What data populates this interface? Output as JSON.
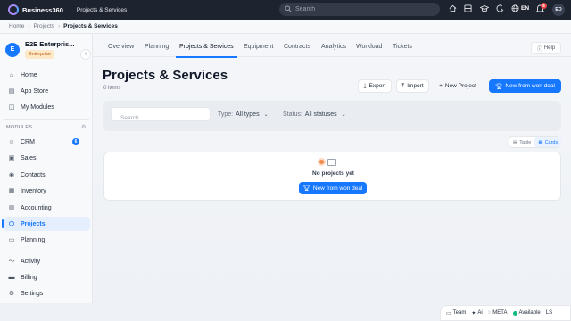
{
  "topbar": {
    "brand": "Business360",
    "section": "Projects & Services",
    "search_placeholder": "Search",
    "language": "EN",
    "notification_count": "8",
    "user_initials": "EO"
  },
  "breadcrumb": [
    "Home",
    "Projects",
    "Projects & Services"
  ],
  "sidebar": {
    "org_initial": "E",
    "org_name": "E2E Enterpris...",
    "org_plan": "Enterprise",
    "collapse_glyph": "‹",
    "top_items": [
      {
        "label": "Home",
        "icon": "home-icon"
      },
      {
        "label": "App Store",
        "icon": "store-icon"
      },
      {
        "label": "My Modules",
        "icon": "modules-icon"
      }
    ],
    "modules_label": "MODULES",
    "module_items": [
      {
        "label": "CRM",
        "icon": "crm-icon",
        "badge": "6"
      },
      {
        "label": "Sales",
        "icon": "sales-icon"
      },
      {
        "label": "Contacts",
        "icon": "contacts-icon"
      },
      {
        "label": "Inventory",
        "icon": "inventory-icon"
      },
      {
        "label": "Accounting",
        "icon": "accounting-icon"
      },
      {
        "label": "Projects",
        "icon": "projects-icon",
        "active": true
      },
      {
        "label": "Planning",
        "icon": "planning-icon"
      }
    ],
    "bottom_items": [
      {
        "label": "Activity",
        "icon": "activity-icon"
      },
      {
        "label": "Billing",
        "icon": "billing-icon"
      },
      {
        "label": "Settings",
        "icon": "settings-icon"
      }
    ]
  },
  "tabs": [
    "Overview",
    "Planning",
    "Projects & Services",
    "Equipment",
    "Contracts",
    "Analytics",
    "Workload",
    "Tickets"
  ],
  "active_tab": "Projects & Services",
  "help_label": "Help",
  "page": {
    "title": "Projects & Services",
    "item_count": "0 items",
    "export_label": "Export",
    "import_label": "Import",
    "new_project_label": "New Project",
    "new_from_deal_label": "New from won deal"
  },
  "filters": {
    "search_placeholder": "Search...",
    "type_label": "Type:",
    "type_value": "All types",
    "status_label": "Status:",
    "status_value": "All statuses"
  },
  "view_toggle": {
    "table": "Table",
    "cards": "Cards",
    "active": "Cards"
  },
  "empty_state": {
    "title": "No projects yet",
    "button_label": "New from won deal"
  },
  "bottom_bar": {
    "team": "Team",
    "ai": "Ai",
    "meta": "META",
    "status": "Available",
    "extra": "LS"
  },
  "colors": {
    "accent": "#1677ff",
    "topbar": "#1e2330",
    "available": "#10b981",
    "notification": "#ef4444",
    "enterprise_badge": "#fde9c8"
  }
}
